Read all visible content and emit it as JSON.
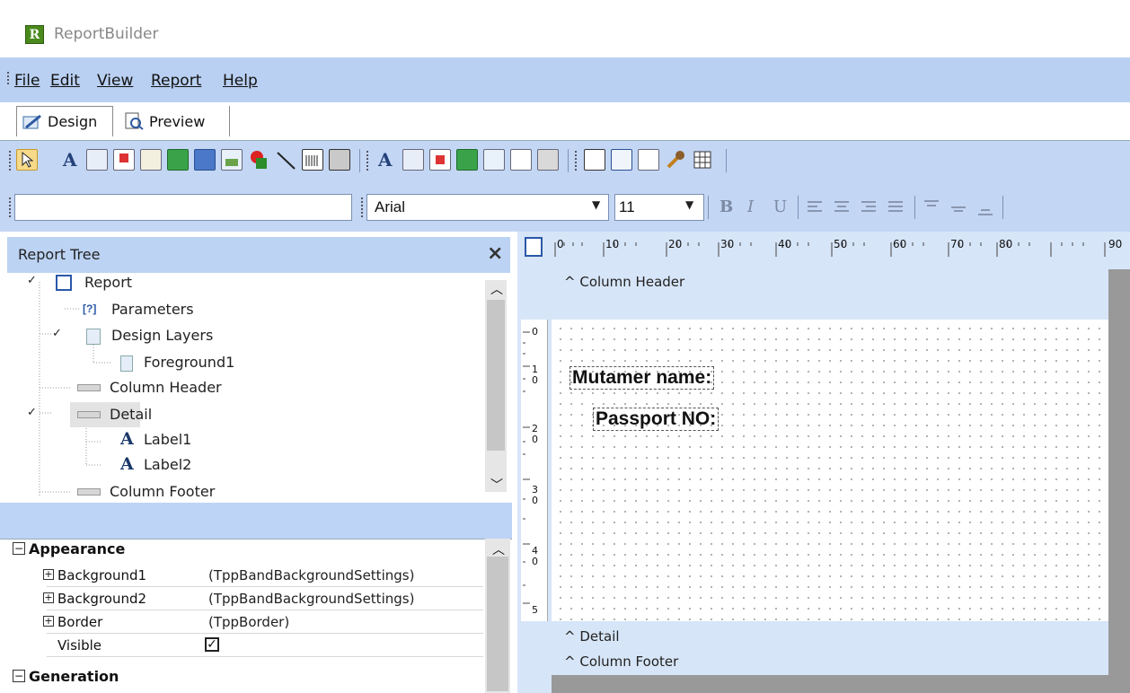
{
  "app": {
    "title": "ReportBuilder",
    "logo_letter": "R"
  },
  "menu": [
    "File",
    "Edit",
    "View",
    "Report",
    "Help"
  ],
  "tabs": {
    "design": "Design",
    "preview": "Preview"
  },
  "toolbar2": {
    "font_name": "Arial",
    "font_size": "11"
  },
  "report_tree": {
    "title": "Report Tree",
    "nodes": [
      "Report",
      "Parameters",
      "Design Layers",
      "Foreground1",
      "Column Header",
      "Detail",
      "Label1",
      "Label2",
      "Column Footer"
    ]
  },
  "properties": {
    "categories": [
      "Appearance",
      "Generation"
    ],
    "rows": [
      {
        "name": "Background1",
        "value": "(TppBandBackgroundSettings)"
      },
      {
        "name": "Background2",
        "value": "(TppBandBackgroundSettings)"
      },
      {
        "name": "Border",
        "value": "(TppBorder)"
      },
      {
        "name": "Visible",
        "value": ""
      }
    ]
  },
  "ruler": {
    "h_labels": [
      "0",
      "10",
      "20",
      "30",
      "40",
      "50",
      "60",
      "70",
      "80",
      "90"
    ],
    "v_labels": [
      "0",
      "1\n0",
      "2\n0",
      "3\n0",
      "4\n0",
      "5"
    ]
  },
  "designer": {
    "bands": {
      "column_header": "Column Header",
      "detail": "Detail",
      "column_footer": "Column Footer"
    },
    "labels": [
      "Mutamer name:",
      "Passport NO:"
    ]
  },
  "colors": {
    "menubar": "#b9d0f2",
    "toolbar": "#c3d6f4",
    "designer_bg": "#d7e5f8"
  }
}
